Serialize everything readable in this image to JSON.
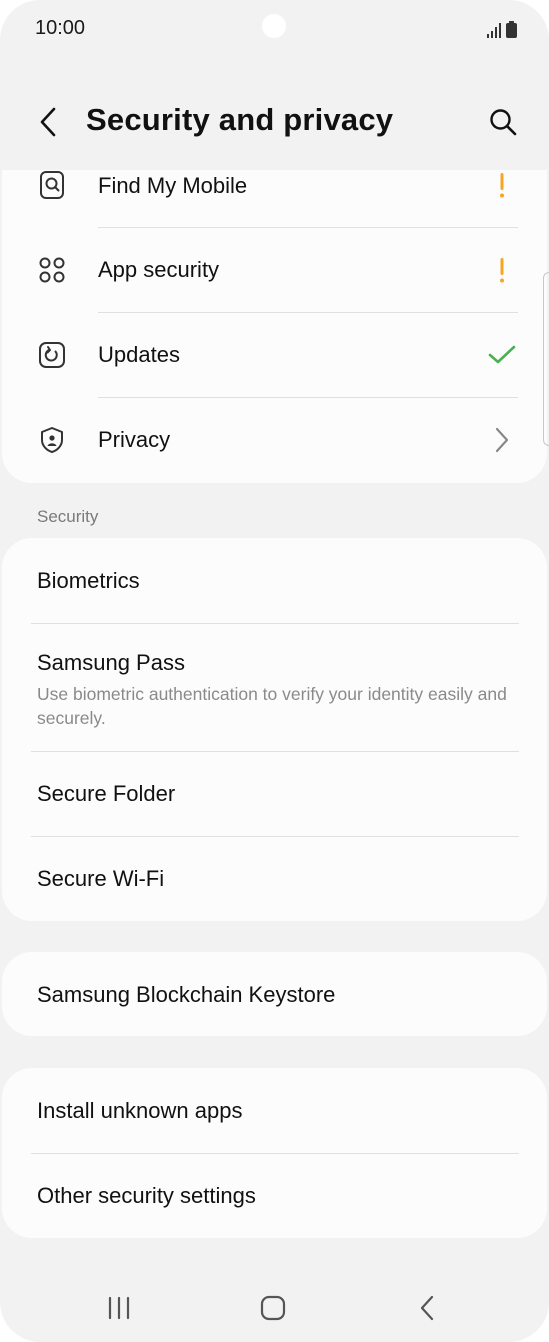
{
  "status_bar": {
    "time": "10:00"
  },
  "header": {
    "title": "Security and privacy"
  },
  "top_items": [
    {
      "label": "Find My Mobile",
      "icon": "find-my-mobile-icon",
      "indicator": "warning"
    },
    {
      "label": "App security",
      "icon": "app-security-icon",
      "indicator": "warning"
    },
    {
      "label": "Updates",
      "icon": "updates-icon",
      "indicator": "check"
    },
    {
      "label": "Privacy",
      "icon": "privacy-shield-icon",
      "indicator": "chevron"
    }
  ],
  "security_section": {
    "label": "Security",
    "items": [
      {
        "label": "Biometrics"
      },
      {
        "label": "Samsung Pass",
        "sublabel": "Use biometric authentication to verify your identity easily and securely."
      },
      {
        "label": "Secure Folder"
      },
      {
        "label": "Secure Wi-Fi"
      }
    ]
  },
  "blockchain_item": {
    "label": "Samsung Blockchain Keystore"
  },
  "other_items": [
    {
      "label": "Install unknown apps"
    },
    {
      "label": "Other security settings"
    }
  ],
  "colors": {
    "warning": "#f5a623",
    "check": "#4caf50",
    "background": "#f2f2f2",
    "card": "#fcfcfc"
  }
}
